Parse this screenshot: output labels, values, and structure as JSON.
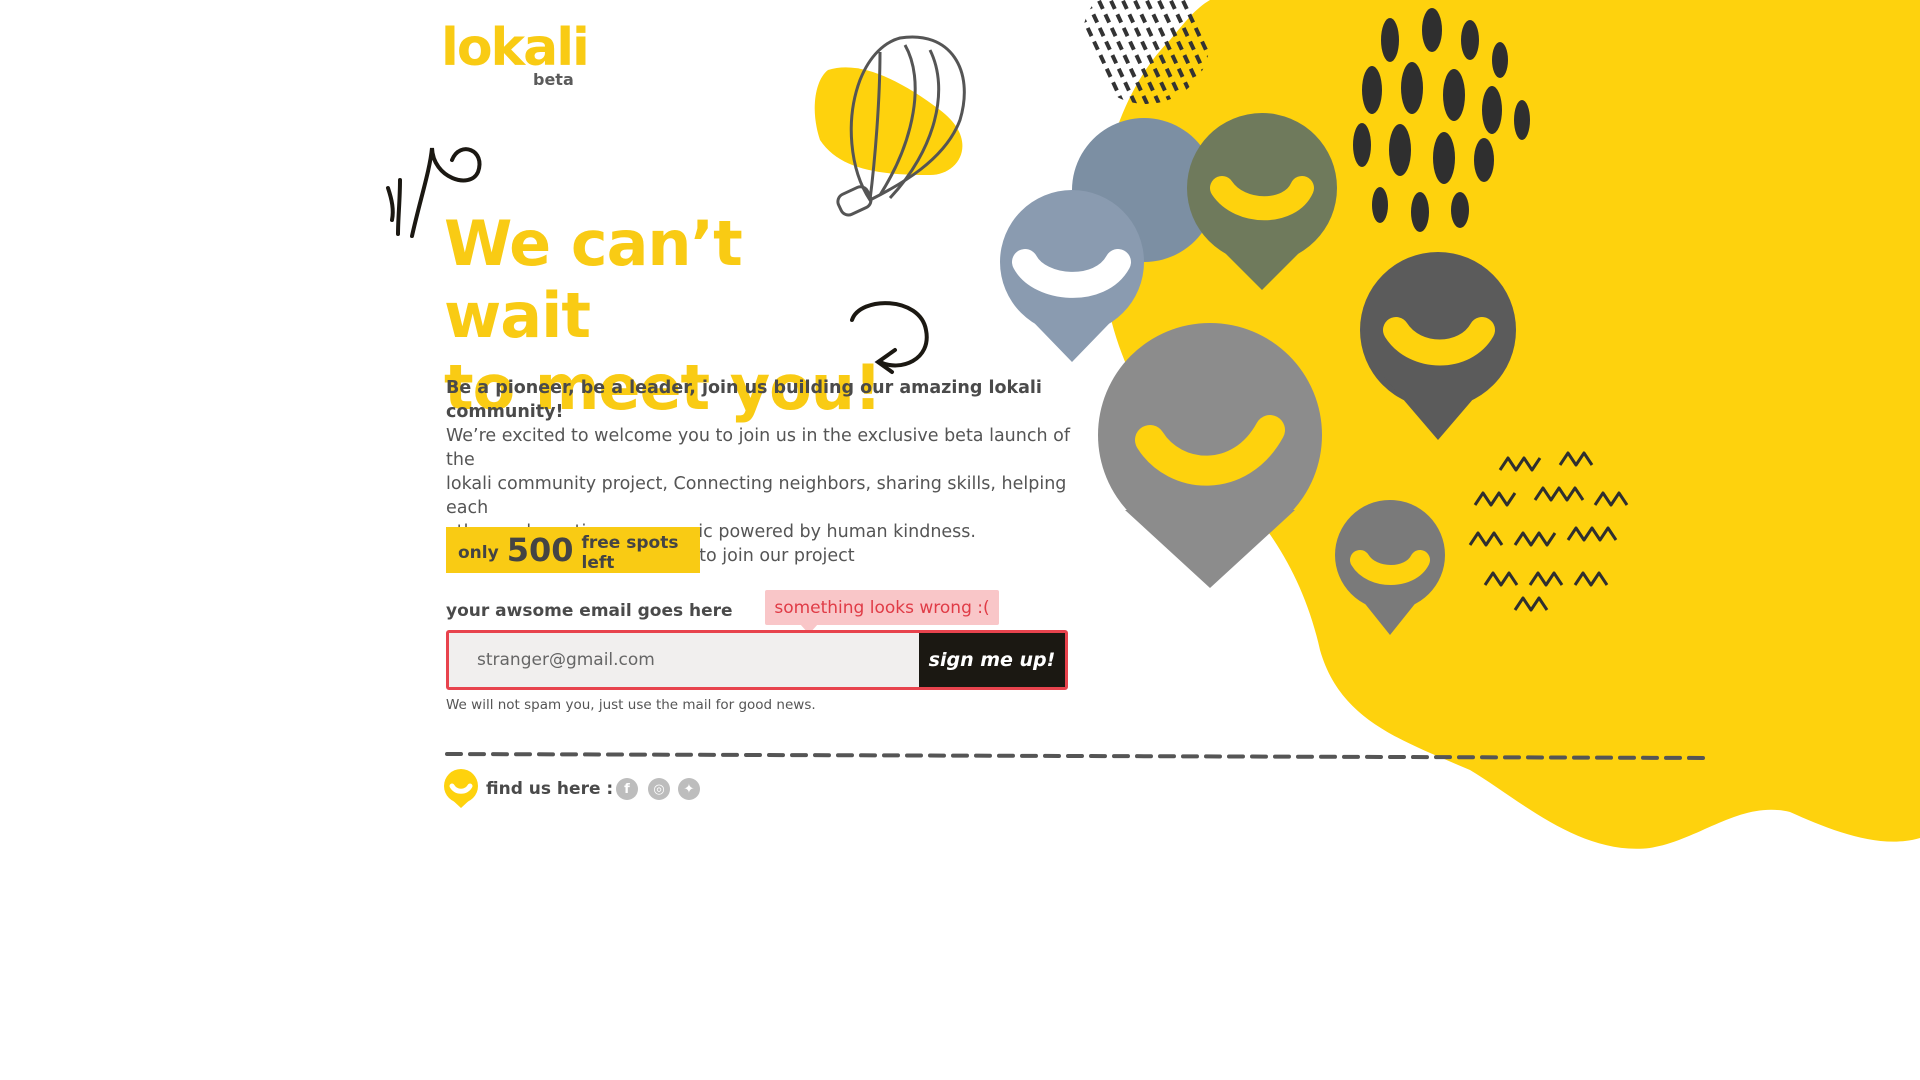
{
  "brand": {
    "name": "lokali",
    "tag": "beta"
  },
  "hero": {
    "title_line1": "We can’t wait",
    "title_line2": "to meet you!"
  },
  "intro": {
    "lead": "Be a pioneer, be a leader, join us building our amazing lokali community!",
    "line1": "We’re excited to welcome you to join us in the exclusive beta launch of the",
    "line2": "lokali community project, Connecting neighbors, sharing skills, helping each",
    "line3": "other and creating pure magic powered by human kindness.",
    "line4": "Sign up now and be the first to join our project"
  },
  "spots": {
    "prefix": "only",
    "count": "500",
    "suffix": "free spots left"
  },
  "form": {
    "label": "your awsome email goes here",
    "error": "something looks wrong :(",
    "email_placeholder": "stranger@gmail.com",
    "submit_label": "sign me up!",
    "note": "We will not spam you, just use the mail for good news."
  },
  "footer": {
    "find_label": "find us here :",
    "social": [
      {
        "icon": "facebook-icon"
      },
      {
        "icon": "instagram-icon"
      },
      {
        "icon": "twitter-icon"
      }
    ]
  },
  "colors": {
    "accent": "#f9cb14",
    "error": "#e8434d",
    "error_bg": "#f9c6c8",
    "button": "#1b1812"
  }
}
